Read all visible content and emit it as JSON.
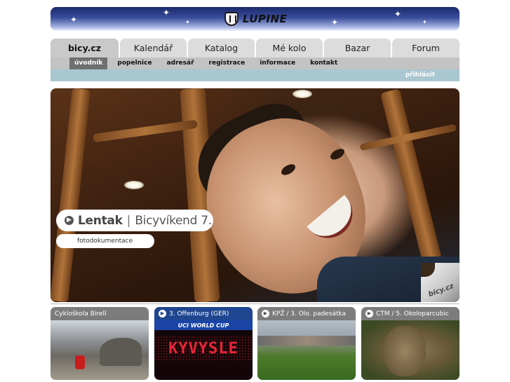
{
  "brand": {
    "logo_text": "LUPINE"
  },
  "tabs": [
    {
      "label": "bicy.cz",
      "active": true
    },
    {
      "label": "Kalendář",
      "active": false
    },
    {
      "label": "Katalog",
      "active": false
    },
    {
      "label": "Mé kolo",
      "active": false
    },
    {
      "label": "Bazar",
      "active": false
    },
    {
      "label": "Forum",
      "active": false
    }
  ],
  "subnav": [
    {
      "label": "úvodník",
      "active": true
    },
    {
      "label": "popelnice",
      "active": false
    },
    {
      "label": "adresář",
      "active": false
    },
    {
      "label": "registrace",
      "active": false
    },
    {
      "label": "informace",
      "active": false
    },
    {
      "label": "kontakt",
      "active": false
    }
  ],
  "login": {
    "label": "přihlásit"
  },
  "hero": {
    "title": "Lentak",
    "separator": "|",
    "subtitle": "Bicyvíkend 7.",
    "link_label": "fotodokumentace",
    "badge_text": "bicy.cz"
  },
  "thumbs": [
    {
      "label": "Cykloškola Birell",
      "theme": "gray"
    },
    {
      "label": "3. Offenburg (GER)",
      "theme": "blue",
      "banner_text": "UCI WORLD CUP",
      "led_text": "KYVYSLE"
    },
    {
      "label": "KPŽ / 3. Olo. padesátka",
      "theme": "gray"
    },
    {
      "label": "CTM / 5. Okoloparcubic",
      "theme": "gray"
    }
  ],
  "colors": {
    "subnav_active": "#6f6f6f",
    "login_bar": "#a9c7d0",
    "thumb_header_gray": "#7c7c7c",
    "thumb_header_blue": "#1f4690"
  }
}
